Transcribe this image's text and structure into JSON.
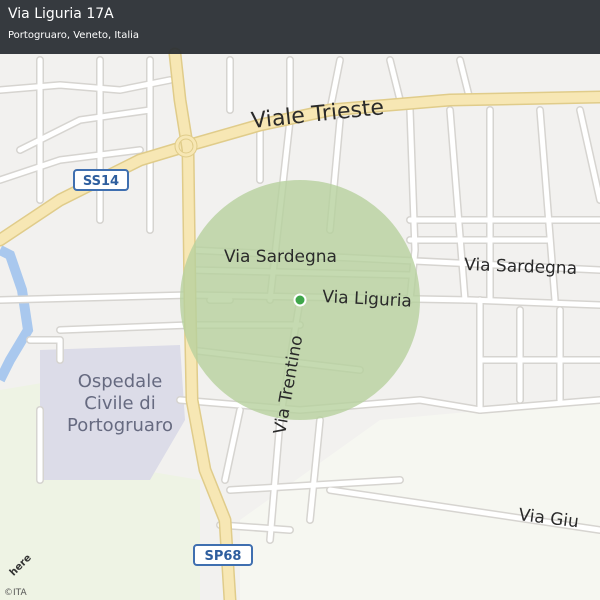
{
  "header": {
    "title": "Via Liguria 17A",
    "subtitle": "Portogruaro, Veneto, Italia"
  },
  "streets": {
    "viale_trieste": "Viale Trieste",
    "via_sardegna_1": "Via Sardegna",
    "via_sardegna_2": "Via Sardegna",
    "via_liguria": "Via Liguria",
    "via_trentino": "Via Trentino",
    "via_giu": "Via Giu"
  },
  "poi": {
    "hospital_line1": "Ospedale",
    "hospital_line2": "Civile di",
    "hospital_line3": "Portogruaro"
  },
  "shields": {
    "ss14": "SS14",
    "sp68": "SP68"
  },
  "branding": {
    "logo": "here",
    "copyright": "©ITA"
  },
  "colors": {
    "background": "#f2f1ef",
    "road": "#ffffff",
    "road_outline": "#d6d4d0",
    "major_road": "#f7e7b4",
    "water": "#a9c8ee",
    "park": "#eef3e4",
    "hospital_area": "#dcdce8",
    "accuracy_circle": "#b7d19e",
    "location_marker": "#3fa64a"
  }
}
